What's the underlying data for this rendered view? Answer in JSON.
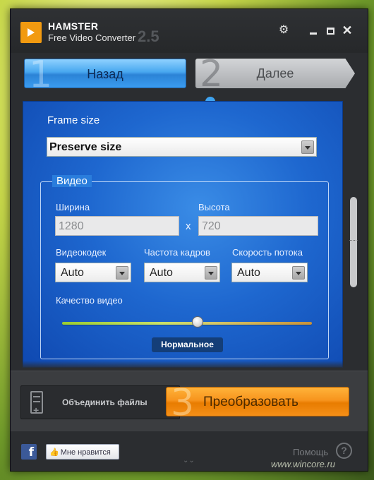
{
  "app": {
    "name": "HAMSTER",
    "subtitle": "Free Video Converter",
    "version": "2.5"
  },
  "steps": {
    "back": {
      "number": "1",
      "label": "Назад"
    },
    "next": {
      "number": "2",
      "label": "Далее"
    },
    "convert": {
      "number": "3",
      "label": "Преобразовать"
    }
  },
  "frame_size": {
    "label": "Frame size",
    "selected": "Preserve size"
  },
  "video_group": {
    "title": "Видео",
    "width_label": "Ширина",
    "width_value": "1280",
    "separator": "x",
    "height_label": "Высота",
    "height_value": "720",
    "codec_label": "Видеокодек",
    "codec_value": "Auto",
    "framerate_label": "Частота кадров",
    "framerate_value": "Auto",
    "bitrate_label": "Скорость потока",
    "bitrate_value": "Auto",
    "quality_label": "Качество видео",
    "quality_level": 0.5,
    "quality_value": "Нормальное"
  },
  "bottom": {
    "merge_label": "Объединить файлы"
  },
  "footer": {
    "facebook_letter": "f",
    "like_label": "Мне нравится",
    "help_label": "Помощь",
    "help_symbol": "?"
  },
  "watermark": "www.wincore.ru",
  "colors": {
    "accent_blue": "#1e67cf",
    "convert_orange": "#f7941d",
    "logo_orange": "#f29a10"
  }
}
